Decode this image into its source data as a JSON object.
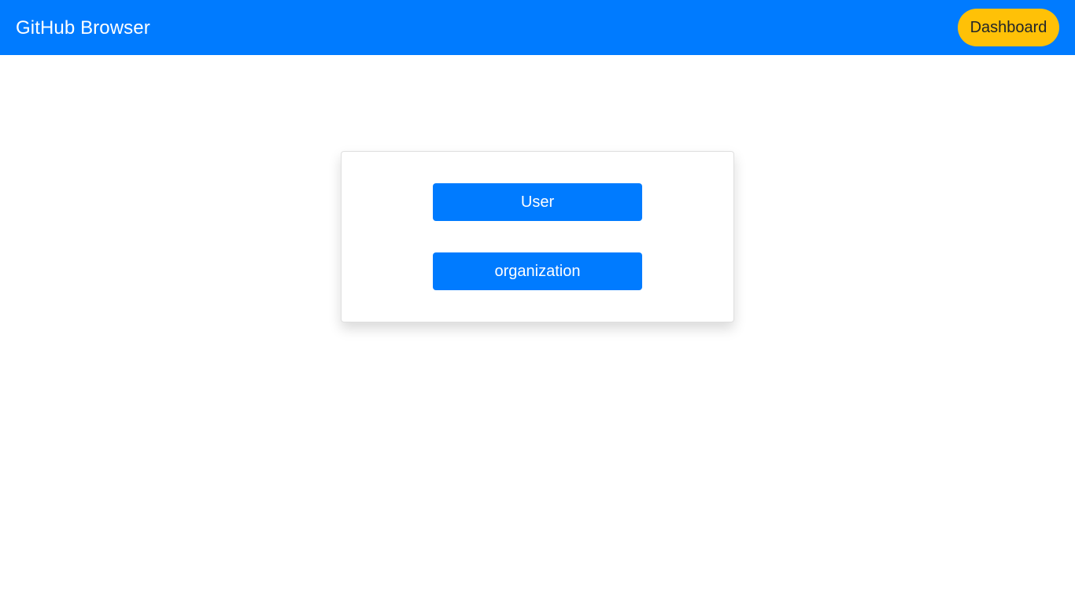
{
  "navbar": {
    "brand": "GitHub Browser",
    "dashboard_label": "Dashboard",
    "background_color": "#007bff",
    "dashboard_color": "#ffc107"
  },
  "card": {
    "user_label": "User",
    "organization_label": "organization",
    "button_color": "#007bff"
  }
}
